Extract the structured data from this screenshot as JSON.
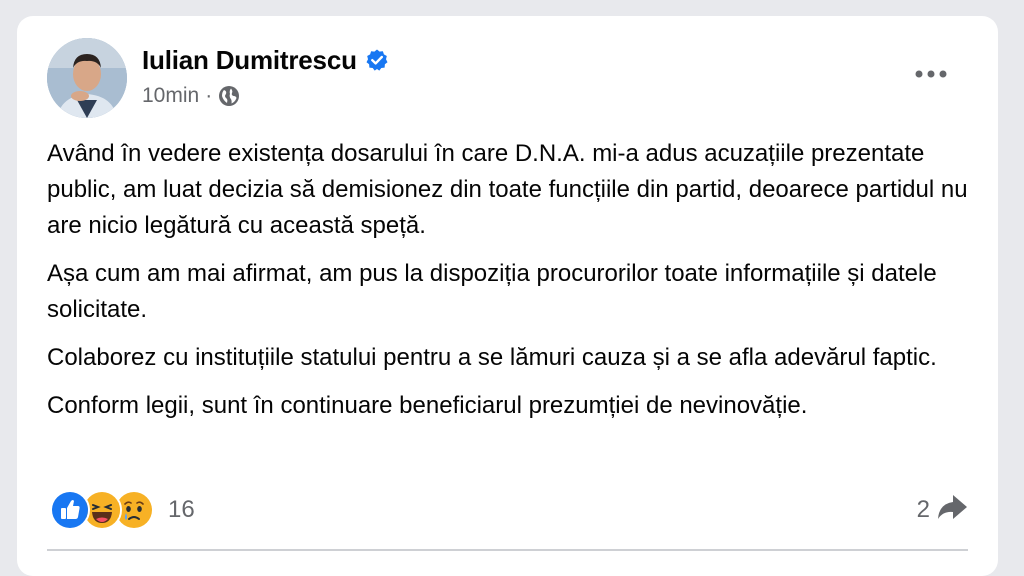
{
  "post": {
    "author": "Iulian Dumitrescu",
    "time": "10min",
    "separator": "·",
    "paragraphs": [
      "Având în vedere existența dosarului în care D.N.A. mi-a adus acuzațiile prezentate public, am luat decizia să demisionez din toate funcțiile din partid, deoarece partidul nu are nicio legătură cu această speță.",
      "Așa cum am mai afirmat, am pus la dispoziția procurorilor toate informațiile și datele solicitate.",
      "Colaborez cu instituțiile statului pentru a se lămuri cauza și a se afla adevărul faptic.",
      "Conform legii, sunt în continuare beneficiarul prezumției de nevinovăție."
    ],
    "reactions": {
      "icons": [
        "like-icon",
        "haha-icon",
        "sad-icon"
      ],
      "count": "16"
    },
    "shares": {
      "count": "2",
      "icon": "share-icon"
    }
  },
  "colors": {
    "accent": "#1877f2",
    "text": "#050505",
    "secondary": "#65676b"
  }
}
